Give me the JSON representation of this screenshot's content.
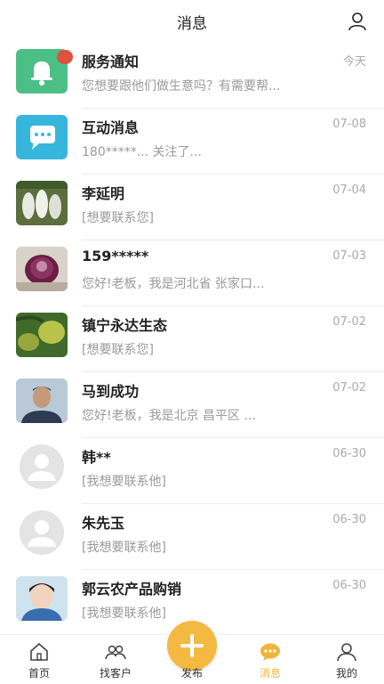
{
  "header": {
    "title": "消息"
  },
  "messages": [
    {
      "name": "服务通知",
      "preview": "您想要跟他们做生意吗？有需要帮...",
      "date": "今天"
    },
    {
      "name": "互动消息",
      "preview": "180*****... 关注了...",
      "date": "07-08"
    },
    {
      "name": "李延明",
      "preview": "[想要联系您]",
      "date": "07-04"
    },
    {
      "name": "159*****",
      "preview": "您好!老板，我是河北省 张家口...",
      "date": "07-03"
    },
    {
      "name": "镇宁永达生态",
      "preview": "[想要联系您]",
      "date": "07-02"
    },
    {
      "name": "马到成功",
      "preview": "您好!老板，我是北京 昌平区 ...",
      "date": "07-02"
    },
    {
      "name": "韩**",
      "preview": "[我想要联系他]",
      "date": "06-30"
    },
    {
      "name": "朱先玉",
      "preview": "[我想要联系他]",
      "date": "06-30"
    },
    {
      "name": "郭云农产品购销",
      "preview": "[我想要联系他]",
      "date": "06-30"
    }
  ],
  "tabbar": {
    "home": "首页",
    "customers": "找客户",
    "publish": "发布",
    "messages": "消息",
    "mine": "我的"
  },
  "colors": {
    "accent": "#f3b940",
    "badge": "#e0503f",
    "service_icon": "#4cbf86",
    "interact_icon": "#36b6dd"
  },
  "icons": [
    "profile-icon",
    "bell-icon",
    "chat-bubble-icon",
    "home-icon",
    "group-icon",
    "plus-icon",
    "message-icon",
    "user-icon"
  ]
}
